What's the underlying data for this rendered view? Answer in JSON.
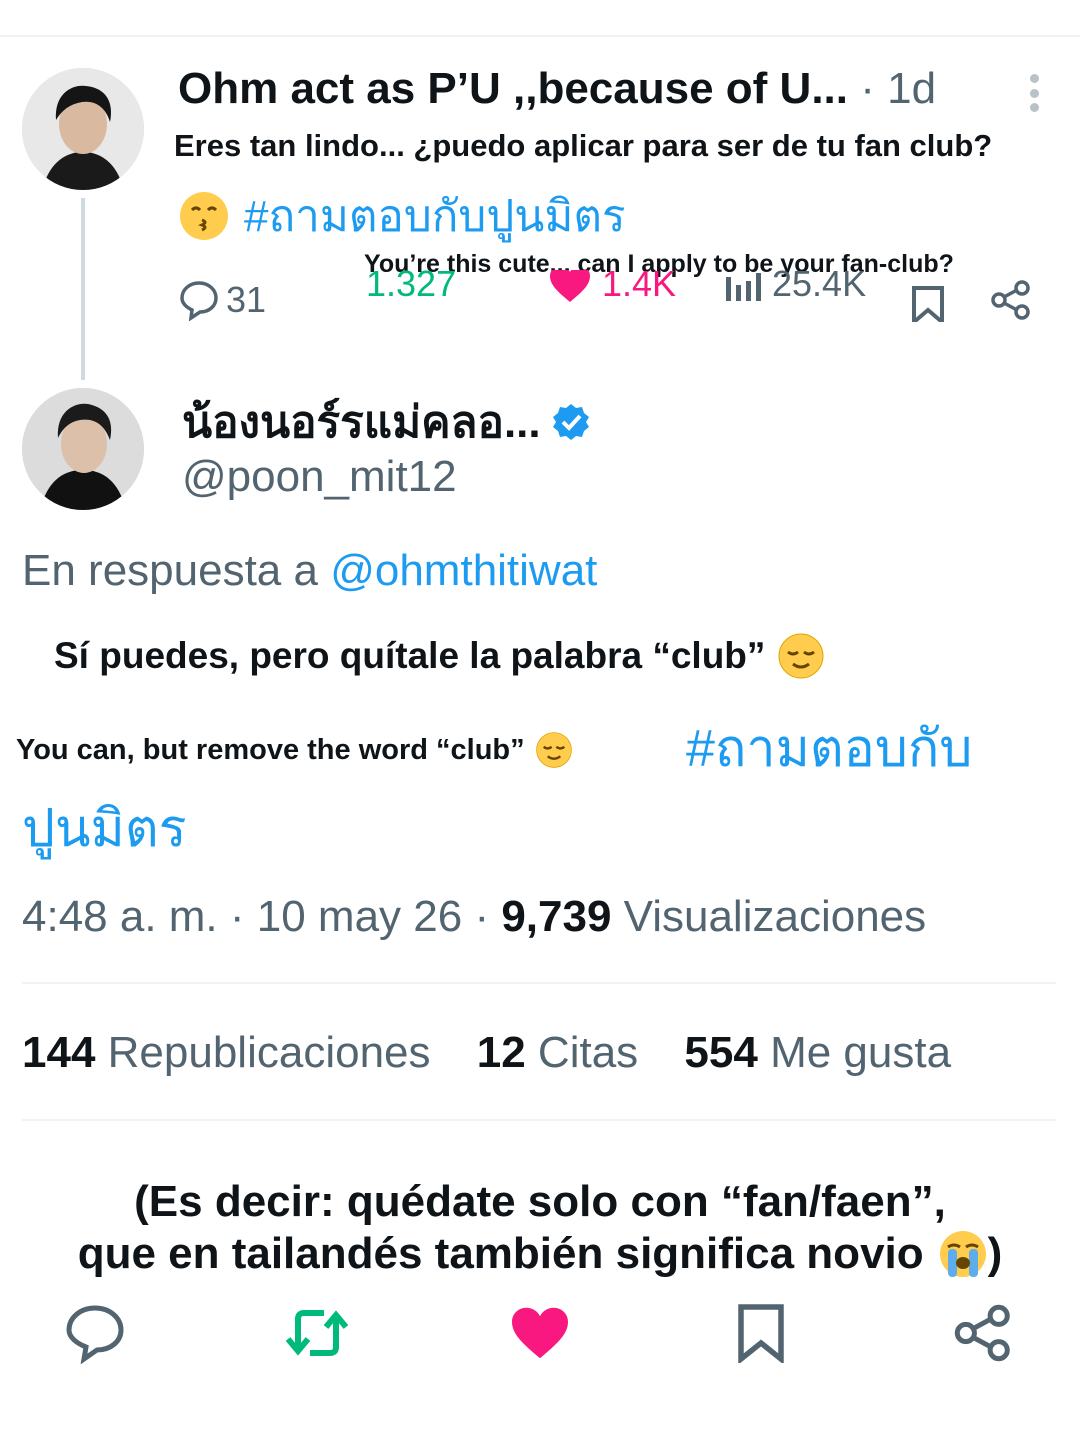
{
  "parent_tweet": {
    "author_name": "Ohm act as P’U ,,because of U...",
    "time": " · 1d",
    "hashtag": "#ถามตอบกับปูนมิตร",
    "stats": {
      "replies": "31",
      "reposts": "1.327",
      "likes": "1.4K",
      "views": "25.4K"
    }
  },
  "caption_es_1": "Eres tan lindo... ¿puedo aplicar para ser de tu fan club?",
  "caption_en_1": "You’re this cute... can I apply to be your fan-club?",
  "reply_tweet": {
    "author_name": "น้องนอร์รแม่คลอ...",
    "handle": "@poon_mit12",
    "in_reply_to_prefix": "En respuesta a ",
    "in_reply_to_mention": "@ohmthitiwat",
    "hashtag_line1": "#ถามตอบกับ",
    "hashtag_line2": "ปูนมิตร",
    "timestamp": "4:48 a. m. · 10 may 26 · ",
    "views_count": "9,739",
    "views_label": " Visualizaciones",
    "reposts_count": "144",
    "reposts_label": " Republicaciones",
    "quotes_count": "12",
    "quotes_label": " Citas",
    "likes_count": "554",
    "likes_label": " Me gusta"
  },
  "caption_es_2": "Sí puedes, pero quítale la palabra “club”",
  "caption_en_2": "You can, but remove the word “club”",
  "explanation_line1": "(Es decir: quédate solo con “fan/faen”,",
  "explanation_line2": "que en tailandés también significa novio",
  "explanation_close": ")",
  "colors": {
    "accent": "#1d9bf0",
    "repost": "#00ba7c",
    "like": "#f91880",
    "muted": "#536471"
  }
}
